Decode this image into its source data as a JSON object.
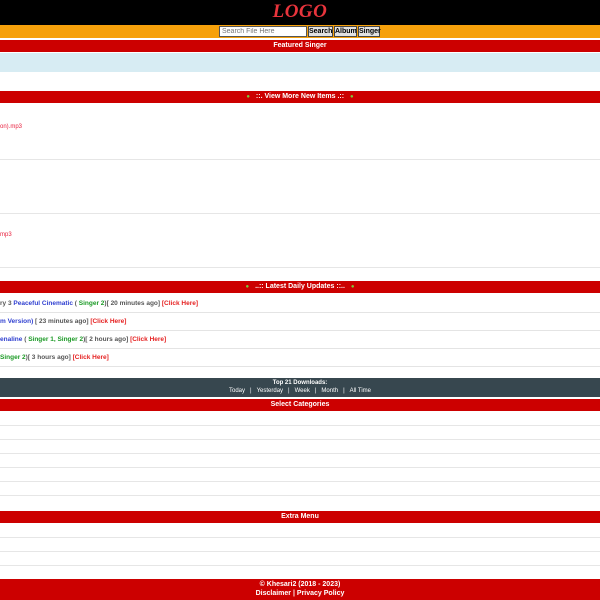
{
  "header": {
    "logo": "LOGO"
  },
  "search": {
    "placeholder": "Search File Here",
    "buttons": {
      "search": "Search",
      "album": "Album",
      "singer": "Singer"
    }
  },
  "sections": {
    "featured": "Featured Singer",
    "view_more": "::. View More New Items .::",
    "latest": "..:: Latest Daily Updates ::..",
    "categories": "Select Categories",
    "extra": "Extra Menu"
  },
  "new_items": [
    {
      "text": "on).mp3"
    },
    {
      "text": ""
    },
    {
      "text": "mp3"
    }
  ],
  "updates": [
    {
      "prefix": "ry 3 ",
      "title": "Peaceful Cinematic",
      "open": " ( ",
      "singers": "Singer 2",
      "close": ")",
      "time": "[ 20 minutes ago]",
      "link": "[Click Here]"
    },
    {
      "prefix": "",
      "title": "m Version)",
      "open": "",
      "singers": "",
      "close": "",
      "time": "[ 23 minutes ago]",
      "link": "[Click Here]"
    },
    {
      "prefix": "",
      "title": "enaline",
      "open": " ( ",
      "singers": "Singer 1, Singer 2",
      "close": ")",
      "time": "[ 2 hours ago]",
      "link": "[Click Here]"
    },
    {
      "prefix": "",
      "title": "",
      "open": "",
      "singers": "Singer 2",
      "close": ")",
      "time": "[ 3 hours ago]",
      "link": "[Click Here]"
    }
  ],
  "top_downloads": {
    "title": "Top 21 Downloads:",
    "links": {
      "today": "Today",
      "yesterday": "Yesterday",
      "week": "Week",
      "month": "Month",
      "all_time": "All Time"
    },
    "separator": "|"
  },
  "footer": {
    "copyright": "© Khesari2 (2018 - 2023)",
    "disclaimer": "Disclaimer",
    "separator": "|",
    "privacy": "Privacy Policy"
  },
  "colors": {
    "header_bg": "#000000",
    "logo": "#e8343c",
    "search_bar": "#f6a10b",
    "section_bar": "#cc0000",
    "featured_panel": "#d7ecf3",
    "top_downloads_bar": "#37474f",
    "link_blue": "#2f3fd0",
    "singer_green": "#1b9a25",
    "click_red": "#e52020"
  }
}
